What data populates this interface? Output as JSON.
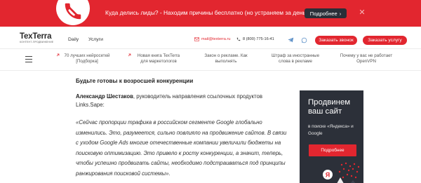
{
  "promo": {
    "text": "Куда делись лиды? - Находим причины бесплатно (но устраняем за деньги)",
    "button_label": "Подробнее",
    "close_glyph": "✕",
    "color": "#e2262f"
  },
  "header": {
    "logo": {
      "name": "TexTerra",
      "subtitle": "контент-продвижение"
    },
    "nav": [
      {
        "label": "Daily"
      },
      {
        "label": "Услуги"
      }
    ],
    "email": "mail@texterra.ru",
    "phone": "8 (800) 775-16-41",
    "call_button": "Заказать звонок",
    "order_button": "Заказать услугу"
  },
  "strip": {
    "items": [
      {
        "line1": "70 лучших нейросетей",
        "line2": "[Подборка]"
      },
      {
        "line1": "Новая книга TexTerra",
        "line2": "для маркетологов"
      },
      {
        "line1": "Закон о рекламе. Как",
        "line2": "выполнять"
      },
      {
        "line1": "Штраф за иностранные",
        "line2": "слова в рекламе"
      },
      {
        "line1": "Почему у вас не работает",
        "line2": "OpenVPN"
      }
    ]
  },
  "article": {
    "heading": "Будьте готовы к возросшей конкуренции",
    "author_name": "Александр Шестаков",
    "author_role": ", руководитель направления ссылочных продуктов Links.Sape:",
    "quote": "«Сейчас пропорции трафика в российском сегменте Google глобально изменились. Это, разумеется, сильно повлияло на продвижение сайтов. В связи с уходом Google Ads многие отечественные компании увеличили бюджеты на поисковую оптимизацию. Это привело к росту конкуренции, а значит, теперь, чтобы успешно продвигать сайты, необходимо подстраиваться под принципы ранжирования поисковой системы»."
  },
  "ad": {
    "title": "Продвинем ваш сайт",
    "subtitle": "в поиске «Яндекса» и Google",
    "button_label": "Подробнее",
    "badge_letter": "Я"
  }
}
